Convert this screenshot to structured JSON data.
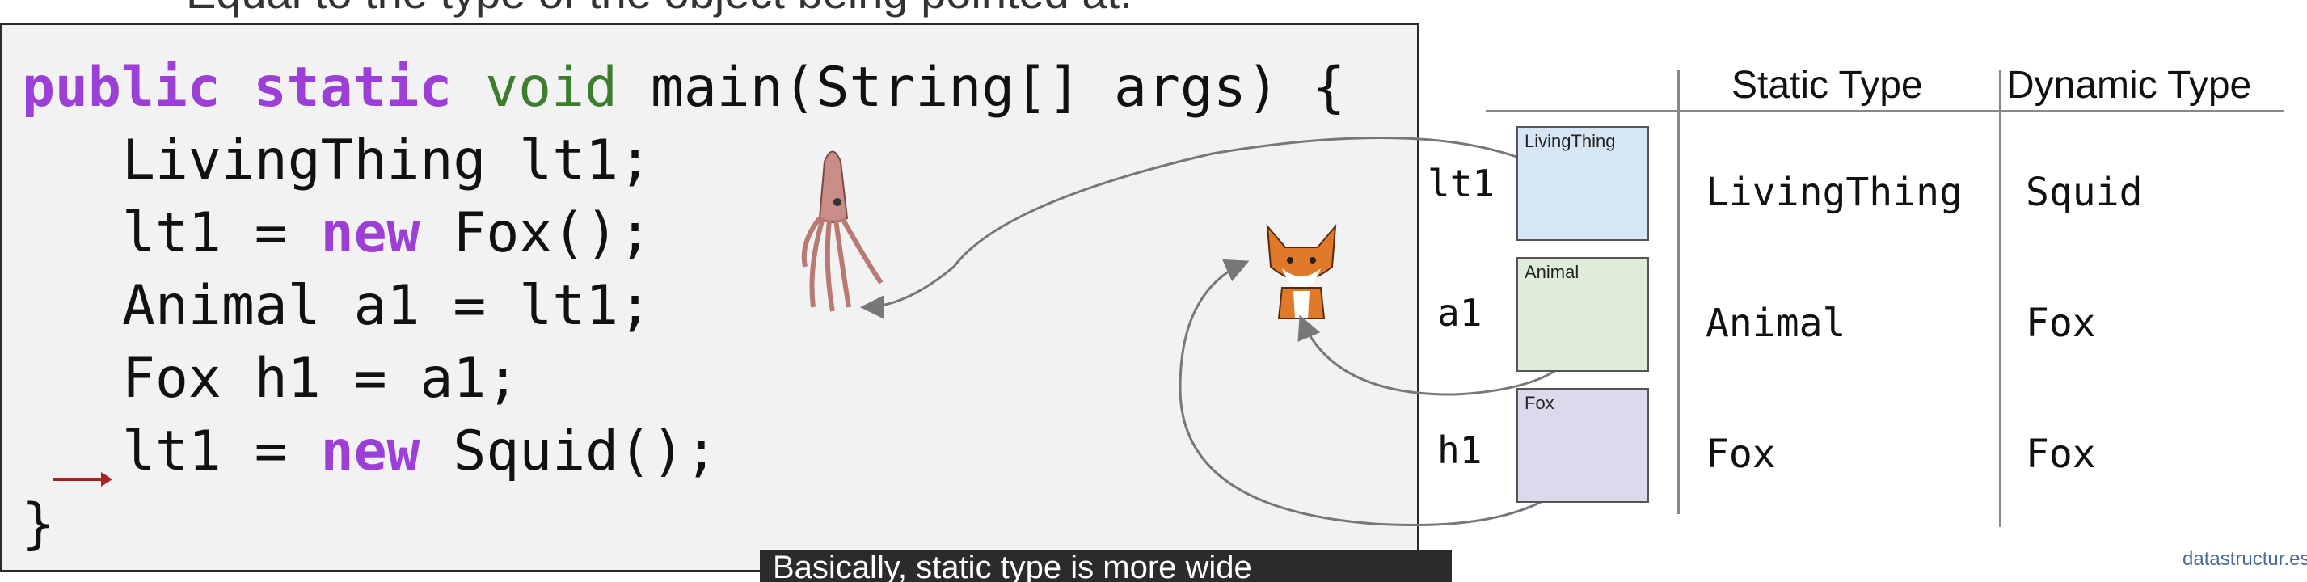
{
  "top_text": "Equal to the type of the object being pointed at.",
  "code": {
    "line1": {
      "kw1": "public",
      "kw2": "static",
      "type": "void",
      "rest": " main(String[] args) {"
    },
    "line2": "LivingThing lt1;",
    "line3": {
      "pre": "lt1 = ",
      "kw": "new",
      "post": " Fox();"
    },
    "line4": "Animal a1 = lt1;",
    "line5": "Fox h1 = a1;",
    "line6": {
      "pre": "lt1 = ",
      "kw": "new",
      "post": " Squid();"
    },
    "line7": "}"
  },
  "table": {
    "headers": {
      "static": "Static Type",
      "dynamic": "Dynamic Type"
    },
    "rows": [
      {
        "var": "lt1",
        "box_label": "LivingThing",
        "static": "LivingThing",
        "dynamic": "Squid",
        "box_color": "#d6e6f5"
      },
      {
        "var": "a1",
        "box_label": "Animal",
        "static": "Animal",
        "dynamic": "Fox",
        "box_color": "#e0ecda"
      },
      {
        "var": "h1",
        "box_label": "Fox",
        "static": "Fox",
        "dynamic": "Fox",
        "box_color": "#dcd9ec"
      }
    ]
  },
  "caption": "Basically, static type is more wide",
  "watermark": "datastructur.es",
  "colors": {
    "keyword": "#9b3fd6",
    "type": "#3d7d2e",
    "marker": "#a22222"
  }
}
